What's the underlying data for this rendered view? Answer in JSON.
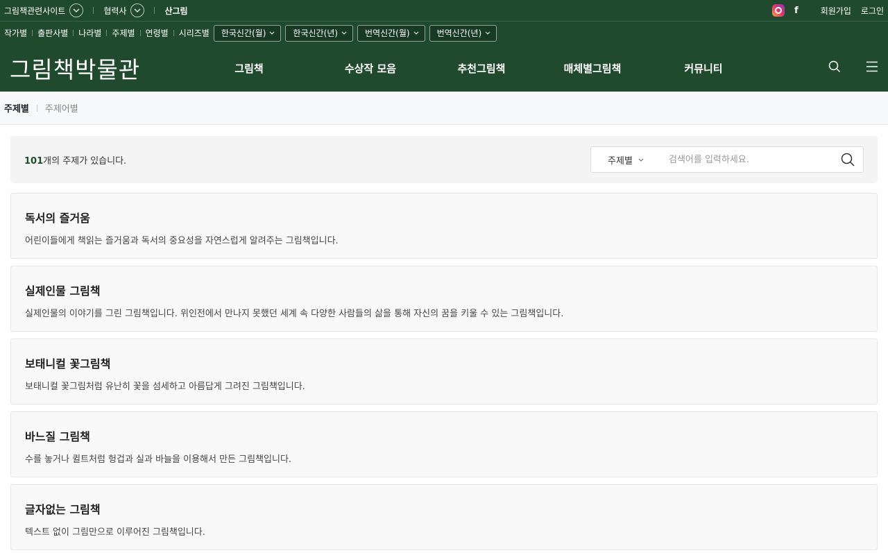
{
  "topbar": {
    "related_sites": "그림책관련사이트",
    "partners": "협력사",
    "sangrim": "산그림",
    "signup": "회원가입",
    "login": "로그인"
  },
  "catbar": {
    "links": [
      "작가별",
      "출판사별",
      "나라별",
      "주제별",
      "연령별",
      "시리즈별"
    ],
    "pills": [
      "한국신간(월)",
      "한국신간(년)",
      "번역신간(월)",
      "번역신간(년)"
    ]
  },
  "header": {
    "logo": "그림책박물관",
    "menu": [
      "그림책",
      "수상작 모음",
      "추천그림책",
      "매체별그림책",
      "커뮤니티"
    ]
  },
  "subnav": {
    "active": "주제별",
    "inactive": "주제어별"
  },
  "search": {
    "count_num": "101",
    "count_text": "개의 주제가 있습니다.",
    "select_label": "주제별",
    "placeholder": "검색어를 입력하세요."
  },
  "themes": [
    {
      "title": "독서의 즐거움",
      "desc": "어린이들에게 책읽는 즐거움과 독서의 중요성을 자연스럽게 알려주는 그림책입니다."
    },
    {
      "title": "실제인물 그림책",
      "desc": "실제인물의 이야기를 그린 그림책입니다. 위인전에서 만나지 못했던 세계 속 다양한 사람들의 삶을 통해 자신의 꿈을 키울 수 있는 그림책입니다."
    },
    {
      "title": "보태니컬 꽃그림책",
      "desc": "보태니컬 꽃그림처럼 유난히 꽃을 섬세하고 아름답게 그려진 그림책입니다."
    },
    {
      "title": "바느질 그림책",
      "desc": "수를 놓거나 퀼트처럼 헝겁과 실과 바늘을 이용해서 만든 그림책입니다."
    },
    {
      "title": "글자없는 그림책",
      "desc": "텍스트 없이 그림만으로 이루어진 그림책입니다."
    }
  ],
  "colors": {
    "brand_green": "#1f4a2e",
    "pill_bg": "#173a23"
  }
}
